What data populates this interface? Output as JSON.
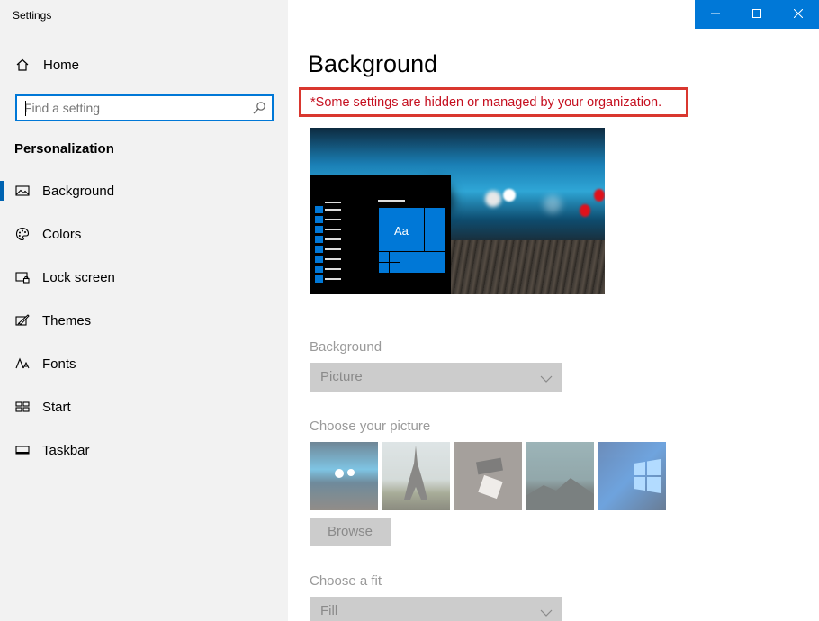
{
  "window": {
    "title": "Settings",
    "controls": {
      "minimize": "minimize",
      "maximize": "maximize",
      "close": "close"
    }
  },
  "sidebar": {
    "home_label": "Home",
    "search_placeholder": "Find a setting",
    "section_heading": "Personalization",
    "items": [
      {
        "label": "Background",
        "icon": "picture-icon",
        "selected": true
      },
      {
        "label": "Colors",
        "icon": "palette-icon",
        "selected": false
      },
      {
        "label": "Lock screen",
        "icon": "lock-screen-icon",
        "selected": false
      },
      {
        "label": "Themes",
        "icon": "themes-icon",
        "selected": false
      },
      {
        "label": "Fonts",
        "icon": "fonts-icon",
        "selected": false
      },
      {
        "label": "Start",
        "icon": "start-icon",
        "selected": false
      },
      {
        "label": "Taskbar",
        "icon": "taskbar-icon",
        "selected": false
      }
    ]
  },
  "main": {
    "title": "Background",
    "managed_notice": "*Some settings are hidden or managed by your organization.",
    "preview": {
      "tile_label": "Aa"
    },
    "background_label": "Background",
    "background_value": "Picture",
    "choose_picture_label": "Choose your picture",
    "browse_label": "Browse",
    "choose_fit_label": "Choose a fit",
    "fit_value": "Fill"
  },
  "colors": {
    "accent": "#0078d7",
    "notice_border": "#d9372f",
    "notice_text": "#c50f1f",
    "sidebar_bg": "#f2f2f2",
    "disabled_control": "#cccccc"
  }
}
